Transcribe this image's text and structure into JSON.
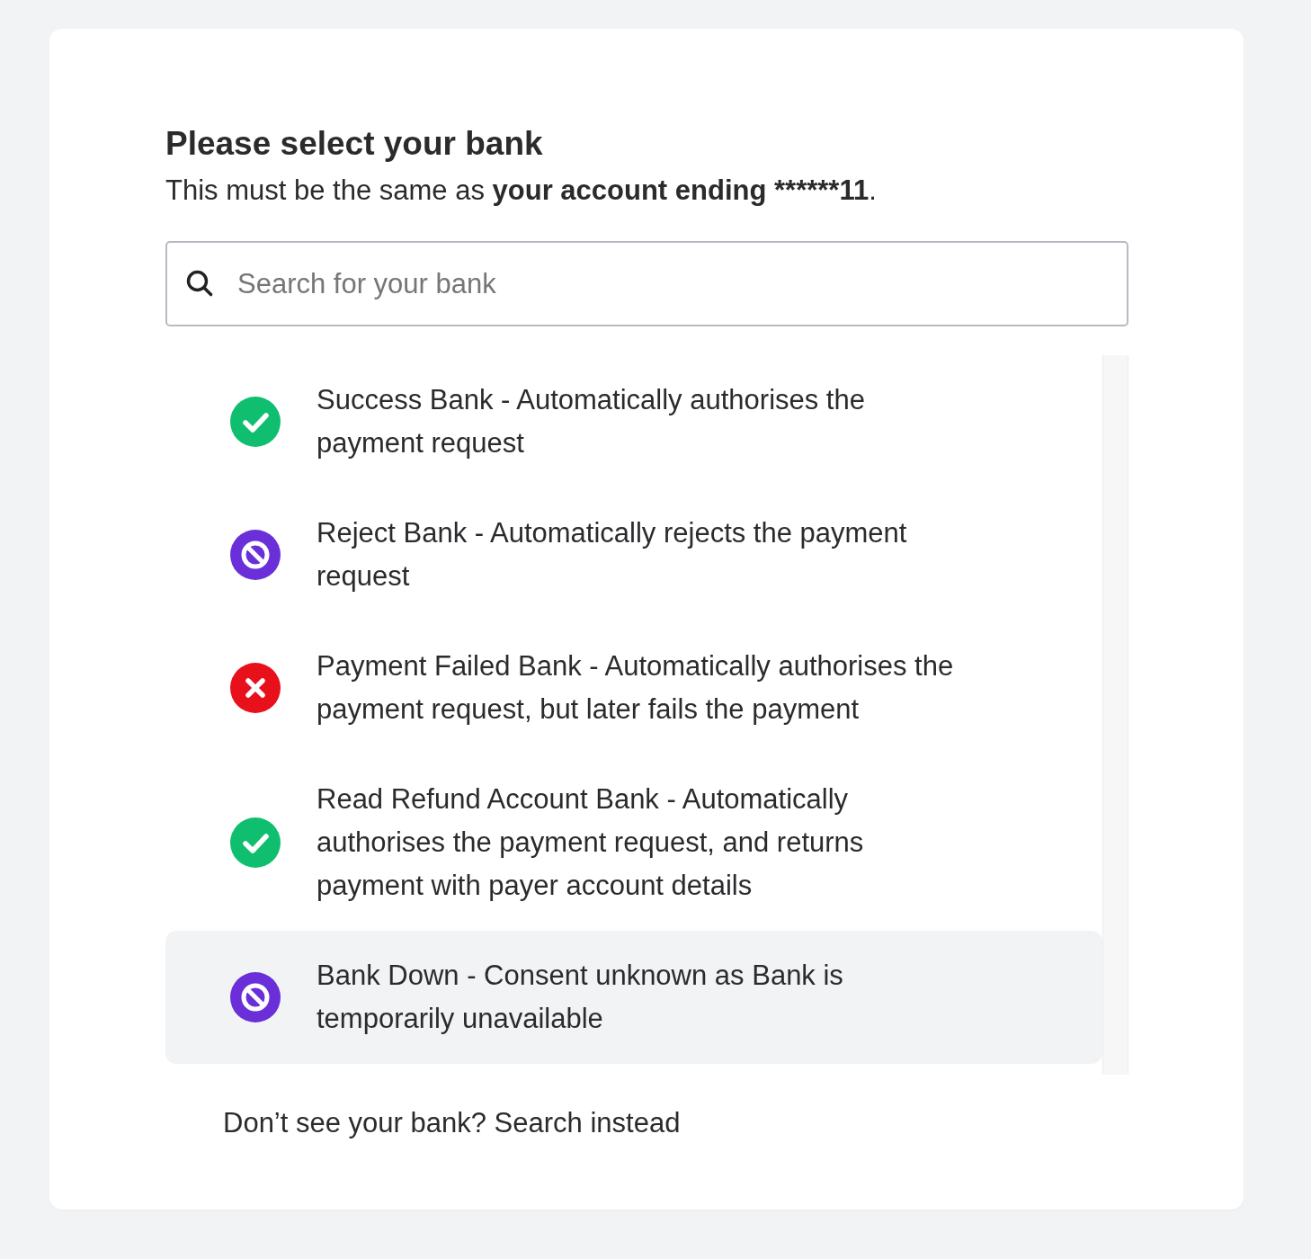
{
  "heading": "Please select your bank",
  "subtitle": {
    "text": "This must be the same as ",
    "bold": "your account ending ******11",
    "end": "."
  },
  "search": {
    "placeholder": "Search for your bank"
  },
  "banks": [
    {
      "kind": "success",
      "label": "Success Bank - Automatically authorises the payment request",
      "selected": false
    },
    {
      "kind": "reject",
      "label": "Reject Bank - Automatically rejects the payment request",
      "selected": false
    },
    {
      "kind": "failed",
      "label": "Payment Failed Bank - Automatically authorises the payment request, but later fails the payment",
      "selected": false
    },
    {
      "kind": "success",
      "label": "Read Refund Account Bank - Automatically authorises the payment request, and returns payment with payer account details",
      "selected": false
    },
    {
      "kind": "reject",
      "label": "Bank Down - Consent unknown as Bank is temporarily unavailable",
      "selected": true
    }
  ],
  "footer_link": "Don’t see your bank? Search instead"
}
